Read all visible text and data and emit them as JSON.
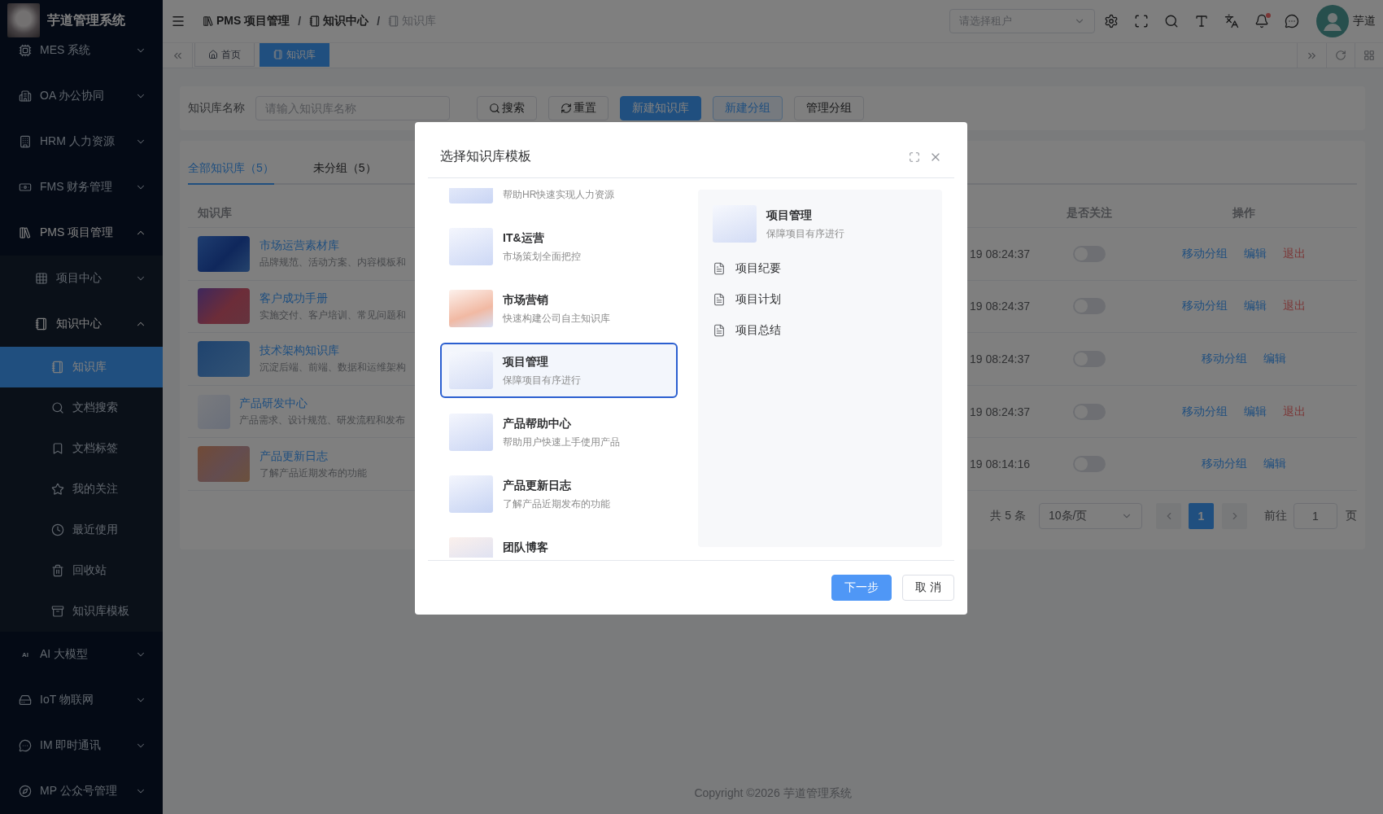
{
  "sidebar": {
    "title": "芋道管理系统",
    "menu": [
      {
        "label": "MES 系统",
        "expanded": false,
        "selected": false
      },
      {
        "label": "OA 办公协同",
        "expanded": false,
        "selected": false
      },
      {
        "label": "HRM 人力资源",
        "expanded": false,
        "selected": false
      },
      {
        "label": "FMS 财务管理",
        "expanded": false,
        "selected": false
      },
      {
        "label": "PMS 项目管理",
        "expanded": true,
        "selected": false,
        "children": [
          {
            "label": "项目中心",
            "expanded": false,
            "selected": false
          },
          {
            "label": "知识中心",
            "expanded": true,
            "selected": false,
            "children": [
              {
                "label": "知识库",
                "selected": true
              },
              {
                "label": "文档搜索",
                "selected": false
              },
              {
                "label": "文档标签",
                "selected": false
              },
              {
                "label": "我的关注",
                "selected": false
              },
              {
                "label": "最近使用",
                "selected": false
              },
              {
                "label": "回收站",
                "selected": false
              },
              {
                "label": "知识库模板",
                "selected": false
              }
            ]
          }
        ]
      },
      {
        "label": "AI 大模型",
        "icon_text": "AI",
        "expanded": false,
        "selected": false
      },
      {
        "label": "IoT 物联网",
        "expanded": false,
        "selected": false
      },
      {
        "label": "IM 即时通讯",
        "expanded": false,
        "selected": false
      },
      {
        "label": "MP 公众号管理",
        "expanded": false,
        "selected": false
      }
    ]
  },
  "header": {
    "breadcrumb": [
      {
        "label": "PMS 项目管理",
        "current": false
      },
      {
        "label": "知识中心",
        "current": false
      },
      {
        "label": "知识库",
        "current": true
      }
    ],
    "breadcrumb_separator": "/",
    "tenant_select": {
      "placeholder": "请选择租户"
    },
    "notification_dot": true,
    "user": {
      "name": "芋道"
    }
  },
  "tags": [
    {
      "label": "首页",
      "selected": false
    },
    {
      "label": "知识库",
      "selected": true
    }
  ],
  "search": {
    "label": "知识库名称",
    "placeholder": "请输入知识库名称",
    "buttons": [
      {
        "label": "搜索",
        "kind": "default"
      },
      {
        "label": "重置",
        "kind": "default"
      },
      {
        "label": "新建知识库",
        "kind": "primary"
      },
      {
        "label": "新建分组",
        "kind": "plain"
      },
      {
        "label": "管理分组",
        "kind": "default"
      }
    ]
  },
  "table_card": {
    "tabs": [
      {
        "label": "全部知识库（5）",
        "selected": true
      },
      {
        "label": "未分组（5）",
        "selected": false
      }
    ],
    "columns": {
      "name": "知识库",
      "followed": "是否关注",
      "actions": "操作"
    },
    "rows": [
      {
        "kind": "cover",
        "title": "市场运营素材库",
        "description": "品牌规范、活动方案、内容模板和",
        "time": "19 08:24:37",
        "followed": false,
        "actions": [
          {
            "label": "移动分组",
            "kind": "link"
          },
          {
            "label": "编辑",
            "kind": "link"
          },
          {
            "label": "退出",
            "kind": "danger"
          }
        ]
      },
      {
        "kind": "cover",
        "title": "客户成功手册",
        "description": "实施交付、客户培训、常见问题和",
        "time": "19 08:24:37",
        "followed": false,
        "actions": [
          {
            "label": "移动分组",
            "kind": "link"
          },
          {
            "label": "编辑",
            "kind": "link"
          },
          {
            "label": "退出",
            "kind": "danger"
          }
        ]
      },
      {
        "kind": "cover",
        "title": "技术架构知识库",
        "description": "沉淀后端、前端、数据和运维架构",
        "time": "19 08:24:37",
        "followed": false,
        "actions": [
          {
            "label": "移动分组",
            "kind": "link"
          },
          {
            "label": "编辑",
            "kind": "link"
          }
        ]
      },
      {
        "kind": "illustration",
        "title": "产品研发中心",
        "description": "产品需求、设计规范、研发流程和发布",
        "time": "19 08:24:37",
        "followed": false,
        "actions": [
          {
            "label": "移动分组",
            "kind": "link"
          },
          {
            "label": "编辑",
            "kind": "link"
          },
          {
            "label": "退出",
            "kind": "danger"
          }
        ]
      },
      {
        "kind": "cover",
        "title": "产品更新日志",
        "description": "了解产品近期发布的功能",
        "time": "19 08:14:16",
        "followed": false,
        "actions": [
          {
            "label": "移动分组",
            "kind": "link"
          },
          {
            "label": "编辑",
            "kind": "link"
          }
        ]
      }
    ],
    "pagination": {
      "total": "共 5 条",
      "page_size": "10条/页",
      "pages": [
        {
          "label": "1",
          "selected": true
        }
      ],
      "goto_label": "前往",
      "goto_value": "1",
      "page_suffix": "页"
    }
  },
  "footer": {
    "copyright": "Copyright ©2026 芋道管理系统"
  },
  "modal": {
    "title": "选择知识库模板",
    "templates": [
      {
        "description": "帮助HR快速实现人力资源",
        "selected": false
      },
      {
        "title": "IT&运营",
        "description": "市场策划全面把控",
        "selected": false
      },
      {
        "title": "市场营销",
        "description": "快速构建公司自主知识库",
        "selected": false
      },
      {
        "title": "项目管理",
        "description": "保障项目有序进行",
        "selected": true
      },
      {
        "title": "产品帮助中心",
        "description": "帮助用户快速上手使用产品",
        "selected": false
      },
      {
        "title": "产品更新日志",
        "description": "了解产品近期发布的功能",
        "selected": false
      },
      {
        "title": "团队博客",
        "selected": false
      }
    ],
    "preview": {
      "title": "项目管理",
      "description": "保障项目有序进行",
      "documents": [
        "项目纪要",
        "项目计划",
        "项目总结"
      ]
    },
    "buttons": [
      {
        "label": "下一步",
        "kind": "primary"
      },
      {
        "label": "取 消",
        "kind": "default"
      }
    ]
  }
}
